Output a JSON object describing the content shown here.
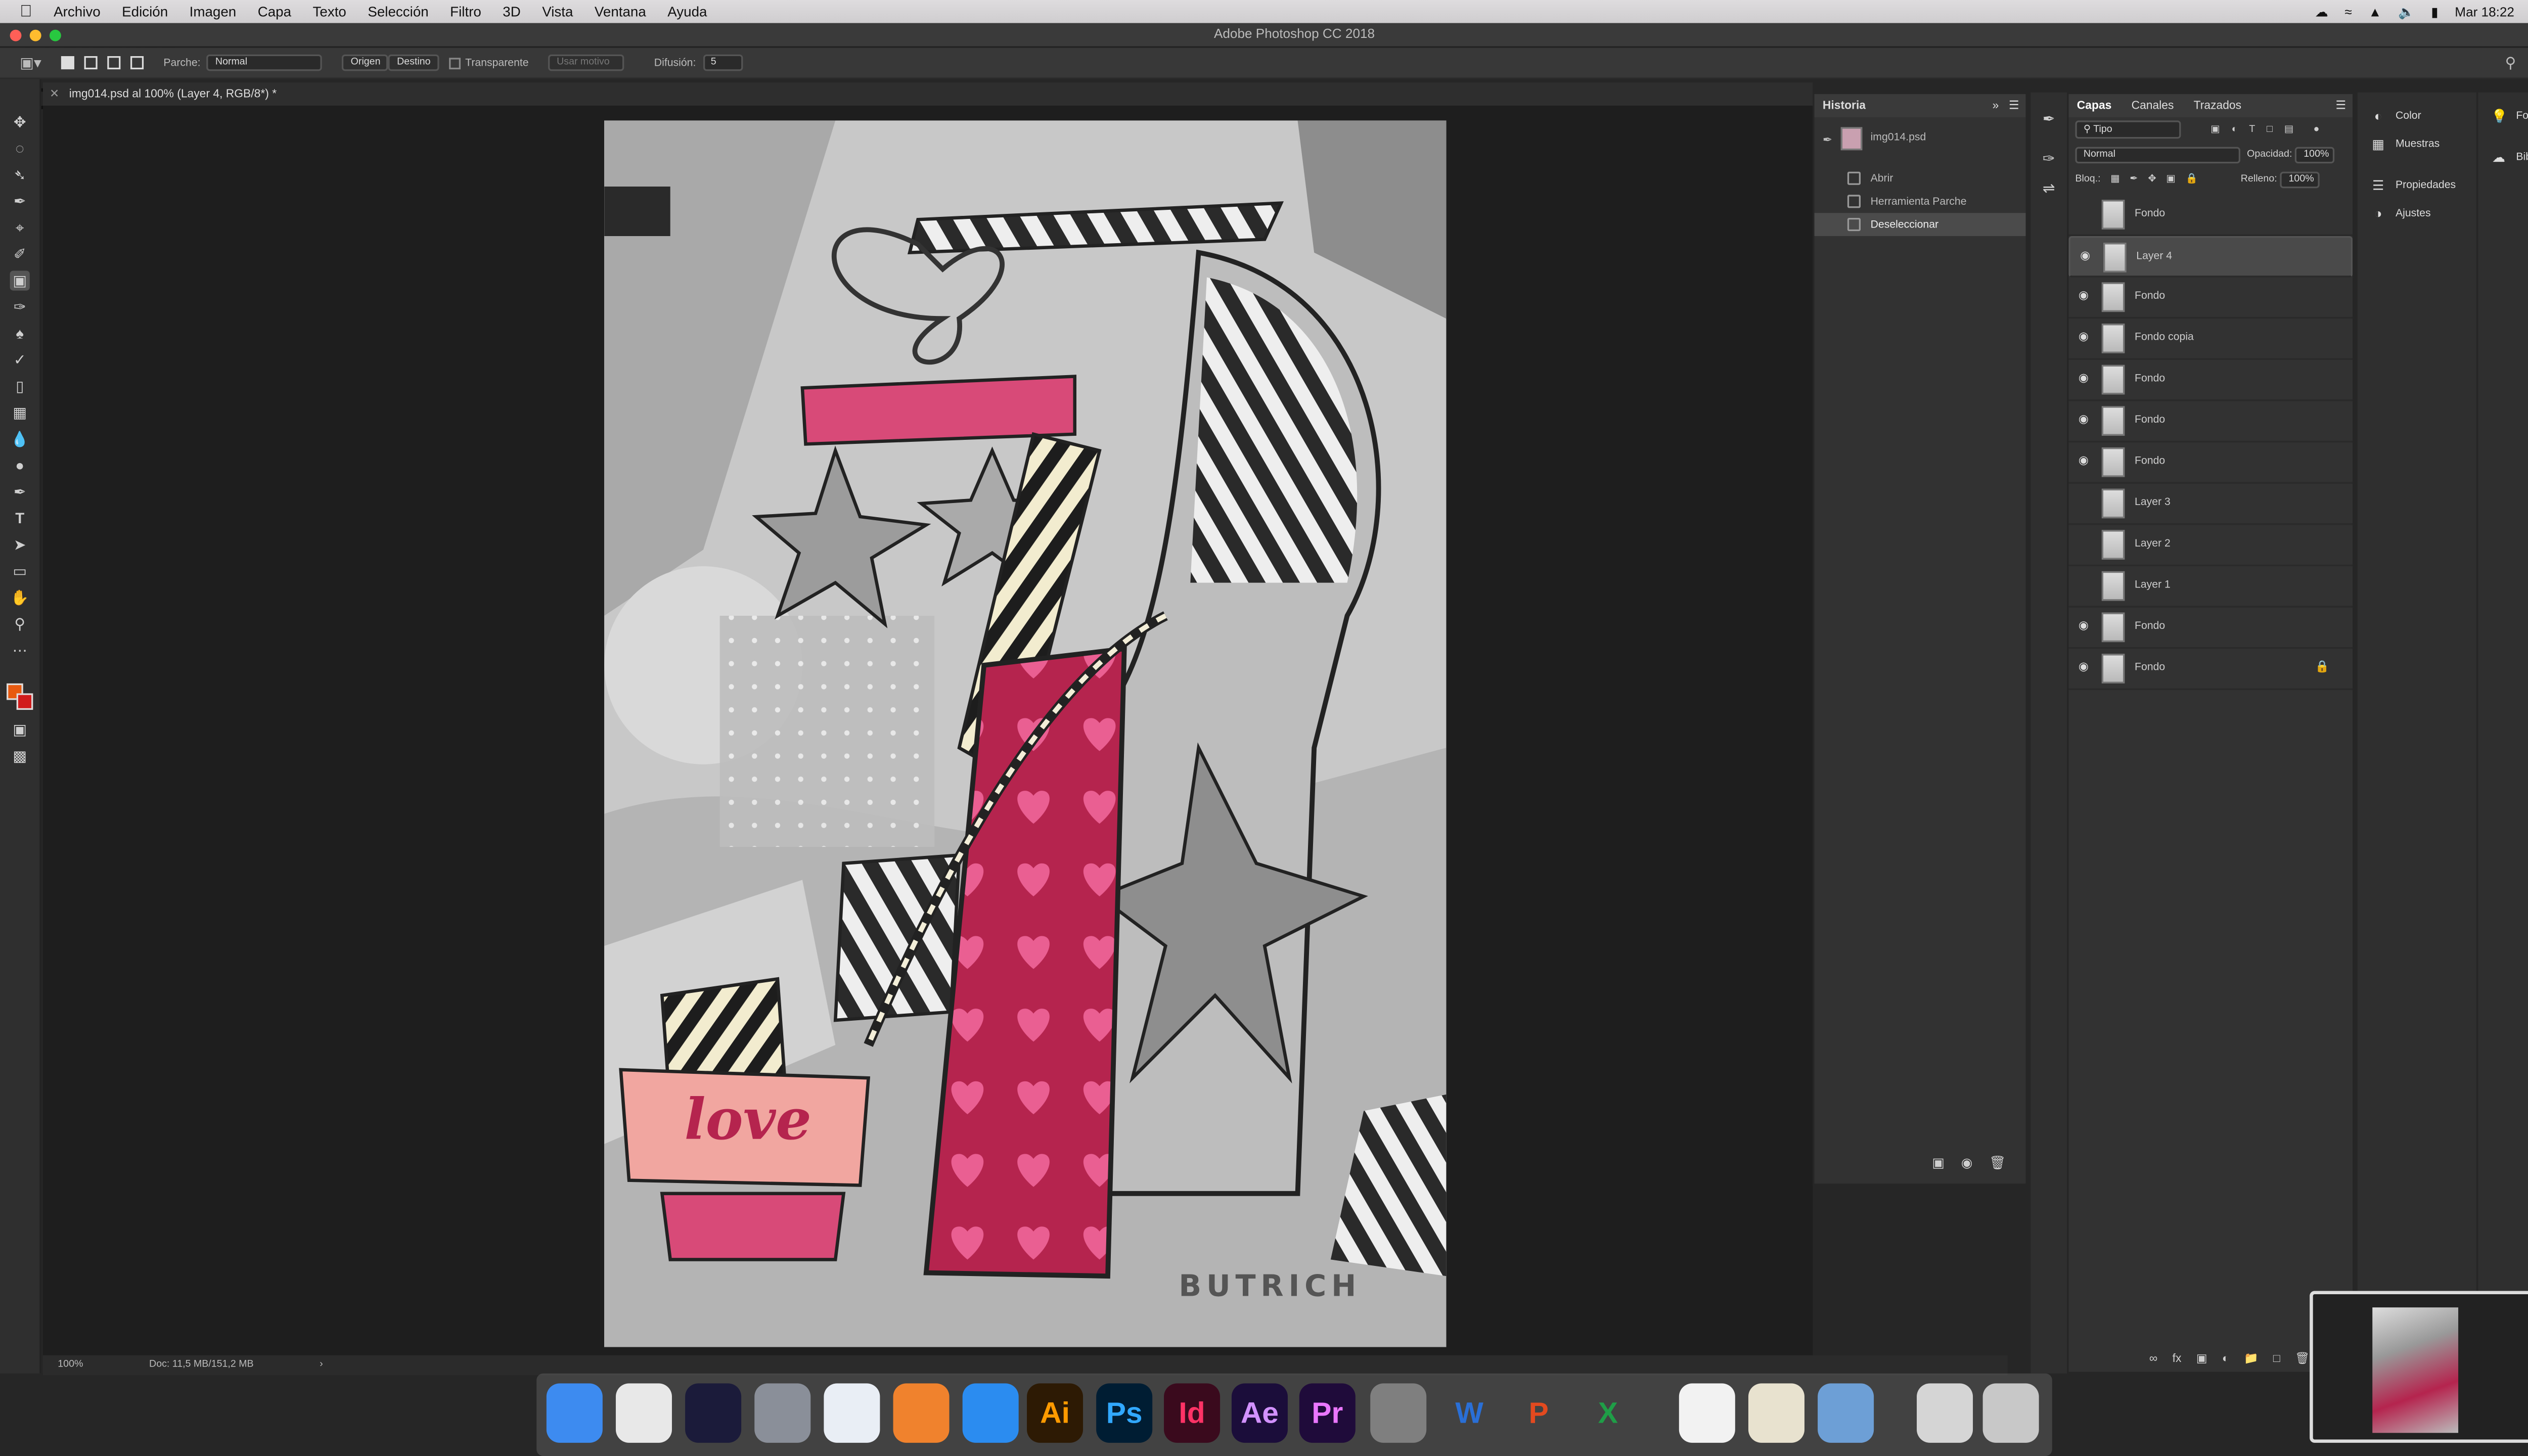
{
  "menubar": {
    "app_name": "Photoshop CC",
    "items": [
      "Archivo",
      "Edición",
      "Imagen",
      "Capa",
      "Texto",
      "Selección",
      "Filtro",
      "3D",
      "Vista",
      "Ventana",
      "Ayuda"
    ],
    "clock": "Mar 18:22"
  },
  "window": {
    "title": "Adobe Photoshop CC 2018"
  },
  "options_bar": {
    "tool_label": "Parche:",
    "mode_value": "Normal",
    "origen_label": "Origen",
    "destino_label": "Destino",
    "transparente_label": "Transparente",
    "usar_motivo_label": "Usar motivo",
    "difusion_label": "Difusión:",
    "difusion_value": "5"
  },
  "document": {
    "tab_label": "img014.psd al 100% (Layer 4, RGB/8*) *",
    "artwork_word": "love",
    "signature": "BUTRICH"
  },
  "status": {
    "zoom": "100%",
    "doc_size": "Doc: 11,5 MB/151,2 MB"
  },
  "history": {
    "title": "Historia",
    "snapshot": "img014.psd",
    "steps": [
      "Abrir",
      "Herramienta Parche",
      "Deseleccionar"
    ]
  },
  "layers_panel": {
    "tabs": [
      "Capas",
      "Canales",
      "Trazados"
    ],
    "filter_value": "Tipo",
    "blend_value": "Normal",
    "opacity_label": "Opacidad:",
    "opacity_value": "100%",
    "lock_label": "Bloq.:",
    "fill_label": "Relleno:",
    "fill_value": "100%",
    "layers": [
      {
        "name": "Fondo",
        "visible": false,
        "selected": false
      },
      {
        "name": "Layer 4",
        "visible": true,
        "selected": true
      },
      {
        "name": "Fondo",
        "visible": true,
        "selected": false
      },
      {
        "name": "Fondo copia",
        "visible": true,
        "selected": false
      },
      {
        "name": "Fondo",
        "visible": true,
        "selected": false
      },
      {
        "name": "Fondo",
        "visible": true,
        "selected": false
      },
      {
        "name": "Fondo",
        "visible": true,
        "selected": false
      },
      {
        "name": "Layer 3",
        "visible": false,
        "selected": false
      },
      {
        "name": "Layer 2",
        "visible": false,
        "selected": false
      },
      {
        "name": "Layer 1",
        "visible": false,
        "selected": false
      },
      {
        "name": "Fondo",
        "visible": true,
        "selected": false
      },
      {
        "name": "Fondo",
        "visible": true,
        "selected": false,
        "locked": true
      }
    ]
  },
  "right_dock": {
    "col1": [
      "Color",
      "Muestras",
      "Propiedades",
      "Ajustes"
    ],
    "col2": [
      "Formación",
      "Bibliotecas"
    ]
  },
  "dock_apps": [
    {
      "name": "finder-icon",
      "label": "",
      "bg": "#3d8bf0",
      "fg": "#ffffff"
    },
    {
      "name": "chrome-icon",
      "label": "",
      "bg": "#e8e8e8",
      "fg": "#ffffff"
    },
    {
      "name": "siri-icon",
      "label": "",
      "bg": "#1b1b3a",
      "fg": "#ffffff"
    },
    {
      "name": "launchpad-icon",
      "label": "",
      "bg": "#8a8f99",
      "fg": "#ffffff"
    },
    {
      "name": "safari-icon",
      "label": "",
      "bg": "#e9eef5",
      "fg": "#2a7ae2"
    },
    {
      "name": "firefox-icon",
      "label": "",
      "bg": "#f0822d",
      "fg": "#ffffff"
    },
    {
      "name": "appstore-icon",
      "label": "",
      "bg": "#2b8cf0",
      "fg": "#ffffff"
    },
    {
      "name": "illustrator-icon",
      "label": "Ai",
      "bg": "#2d1a04",
      "fg": "#ff9a00"
    },
    {
      "name": "photoshop-icon",
      "label": "Ps",
      "bg": "#001d33",
      "fg": "#31a8ff"
    },
    {
      "name": "indesign-icon",
      "label": "Id",
      "bg": "#3a0a1d",
      "fg": "#ff3366"
    },
    {
      "name": "aftereffects-icon",
      "label": "Ae",
      "bg": "#1b0d3a",
      "fg": "#d291ff"
    },
    {
      "name": "premiere-icon",
      "label": "Pr",
      "bg": "#1f0b3a",
      "fg": "#ea77ff"
    },
    {
      "name": "systemprefs-icon",
      "label": "",
      "bg": "#7f7f7f",
      "fg": "#ffffff"
    },
    {
      "name": "word-icon",
      "label": "W",
      "bg": "transparent",
      "fg": "#2a6fd6"
    },
    {
      "name": "powerpoint-icon",
      "label": "P",
      "bg": "transparent",
      "fg": "#e34a1f"
    },
    {
      "name": "excel-icon",
      "label": "X",
      "bg": "transparent",
      "fg": "#1f9e47"
    },
    {
      "name": "photos-icon",
      "label": "",
      "bg": "#f2f2f2",
      "fg": "#ffffff"
    },
    {
      "name": "textedit-icon",
      "label": "",
      "bg": "#e8e2cf",
      "fg": "#ffffff"
    },
    {
      "name": "preview-icon",
      "label": "",
      "bg": "#6d9fd6",
      "fg": "#ffffff"
    },
    {
      "name": "document-stack-icon",
      "label": "",
      "bg": "#d5d5d5",
      "fg": "#ffffff"
    },
    {
      "name": "trash-icon",
      "label": "",
      "bg": "#c8c8c8",
      "fg": "#ffffff"
    }
  ]
}
